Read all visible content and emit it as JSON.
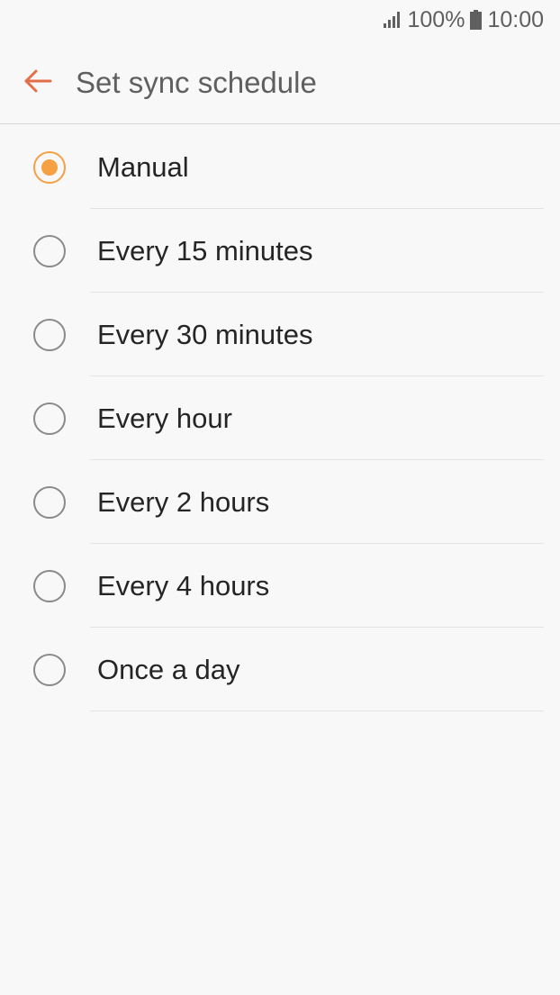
{
  "status_bar": {
    "signal_icon": "signal-strength-icon",
    "battery_percent": "100%",
    "battery_icon": "battery-icon",
    "time": "10:00"
  },
  "app_bar": {
    "back_icon": "arrow-left-icon",
    "title": "Set sync schedule",
    "accent_color": "#e46e4a"
  },
  "options": [
    {
      "label": "Manual",
      "selected": true
    },
    {
      "label": "Every 15 minutes",
      "selected": false
    },
    {
      "label": "Every 30 minutes",
      "selected": false
    },
    {
      "label": "Every hour",
      "selected": false
    },
    {
      "label": "Every 2 hours",
      "selected": false
    },
    {
      "label": "Every 4 hours",
      "selected": false
    },
    {
      "label": "Once a day",
      "selected": false
    }
  ],
  "colors": {
    "selected_radio": "#f4a043",
    "background": "#f8f8f8"
  }
}
